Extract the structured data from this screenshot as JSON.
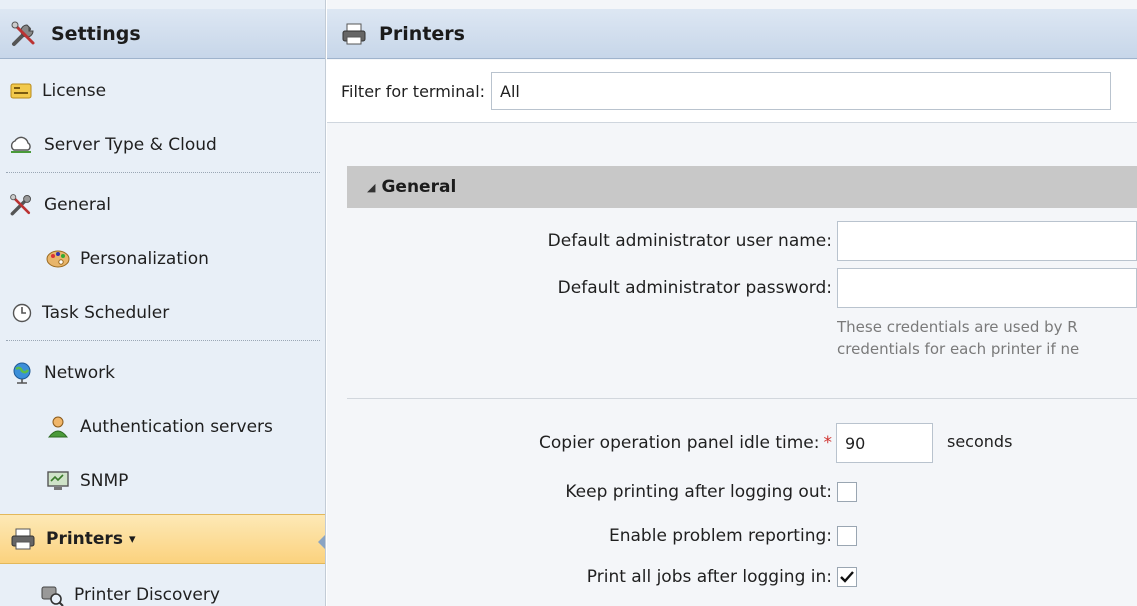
{
  "sidebar": {
    "title": "Settings",
    "items": [
      {
        "label": "License",
        "icon": "license-icon"
      },
      {
        "label": "Server Type & Cloud",
        "icon": "cloud-icon"
      },
      {
        "label": "General",
        "icon": "tools-icon"
      },
      {
        "label": "Personalization",
        "icon": "palette-icon"
      },
      {
        "label": "Task Scheduler",
        "icon": "clock-icon"
      },
      {
        "label": "Network",
        "icon": "globe-icon"
      },
      {
        "label": "Authentication servers",
        "icon": "user-icon"
      },
      {
        "label": "SNMP",
        "icon": "monitor-icon"
      },
      {
        "label": "Printers",
        "icon": "printer-icon",
        "caret": "▾"
      },
      {
        "label": "Printer Discovery",
        "icon": "printer-search-icon"
      }
    ]
  },
  "main": {
    "title": "Printers",
    "filter": {
      "label": "Filter for terminal:",
      "value": "All"
    },
    "section": {
      "title": "General"
    },
    "fields": {
      "admin_user_label": "Default administrator user name:",
      "admin_user_value": "",
      "admin_pass_label": "Default administrator password:",
      "admin_pass_value": "",
      "hint_line1": "These credentials are used by R",
      "hint_line2": "credentials for each printer if ne",
      "idle_label": "Copier operation panel idle time:",
      "idle_required": "*",
      "idle_value": "90",
      "idle_unit": "seconds",
      "keep_printing_label": "Keep printing after logging out:",
      "keep_printing_checked": false,
      "problem_reporting_label": "Enable problem reporting:",
      "problem_reporting_checked": false,
      "print_all_label": "Print all jobs after logging in:",
      "print_all_checked": true
    }
  },
  "colors": {
    "active_item": "#fbd27e",
    "header": "#c7d6e9",
    "section": "#c8c8c8",
    "required": "#d0312d"
  }
}
